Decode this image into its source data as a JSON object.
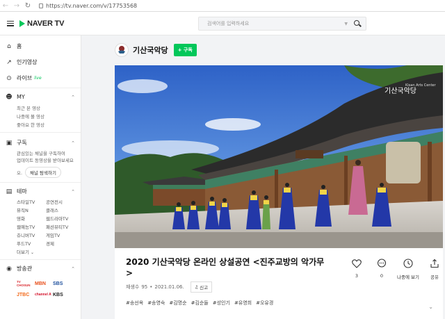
{
  "browser": {
    "url": "https://tv.naver.com/v/17753568",
    "back_icon": "back-arrow-icon",
    "forward_icon": "forward-arrow-icon",
    "reload_icon": "reload-icon"
  },
  "header": {
    "logo_text": "NAVER TV",
    "search_placeholder": "검색어를 입력하세요",
    "accent": "#03c75a"
  },
  "sidebar": {
    "home": "홈",
    "popular": "인기영상",
    "live": "라이브",
    "live_badge": "live",
    "my": "MY",
    "my_items": [
      "최근 본 영상",
      "나중에 볼 영상",
      "좋아요 한 영상"
    ],
    "subscriptions": "구독",
    "subscriptions_desc": [
      "관심있는 채널을 구독하여",
      "업데이트 동영상을 받아보세요"
    ],
    "browse_prefix": "오.",
    "browse_button": "채널 탐색하기",
    "theme": "테마",
    "theme_items": [
      "스타일TV",
      "공연전시",
      "뮤직N",
      "클래스",
      "영화",
      "웹드라마TV",
      "웹예능TV",
      "패션뷰티TV",
      "쥬니버TV",
      "게임TV",
      "푸드TV",
      "경제"
    ],
    "more": "더보기",
    "broadcast": "방송관",
    "broadcast_logos": [
      "TV CHOSUN",
      "MBN",
      "SBS",
      "JTBC",
      "channel A",
      "KBS"
    ]
  },
  "channel": {
    "name": "기산국악당",
    "subscribe_label": "+ 구독",
    "avatar_caption": "기산국악당"
  },
  "video": {
    "watermark": "기산국악당",
    "watermark_small": "Kisan Arts Center",
    "title": "2020 기산국악당 온라인 상설공연 <진주교방의 악가무>",
    "views_label": "재생수",
    "views": "95",
    "date": "2021.01.06.",
    "report_label": "신고",
    "hashtags": [
      "#송선옥",
      "#송영숙",
      "#김명순",
      "#김순들",
      "#성인기",
      "#유영희",
      "#오유경"
    ]
  },
  "actions": [
    {
      "icon": "heart-icon",
      "label": "3"
    },
    {
      "icon": "comment-icon",
      "label": "0"
    },
    {
      "icon": "clock-icon",
      "label": "나중에 보기"
    },
    {
      "icon": "share-icon",
      "label": "공유"
    }
  ]
}
